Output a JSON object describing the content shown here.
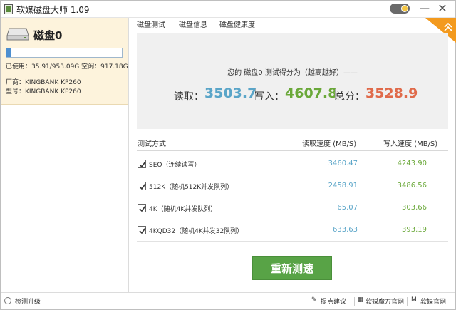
{
  "window": {
    "title": "软媒磁盘大师 1.09"
  },
  "disk": {
    "name": "磁盘0",
    "usage_fraction": 0.0376,
    "usage_text": "已使用：35.91/953.09G 空闲：917.18GB",
    "vendor": "厂商：KINGBANK KP260",
    "model": "型号：KINGBANK KP260"
  },
  "tabs": [
    {
      "label": "磁盘测试",
      "active": true
    },
    {
      "label": "磁盘信息",
      "active": false
    },
    {
      "label": "磁盘健康度",
      "active": false
    }
  ],
  "score": {
    "title": "您的 磁盘0 测试得分为（越高越好）——",
    "read_label": "读取：",
    "read_value": "3503.7",
    "write_label": "写入：",
    "write_value": "4607.8",
    "total_label": "总分：",
    "total_value": "3528.9"
  },
  "table": {
    "headers": {
      "method": "测试方式",
      "read": "读取速度 (MB/S)",
      "write": "写入速度 (MB/S)"
    },
    "rows": [
      {
        "label": "SEQ（连续读写）",
        "read": "3460.47",
        "write": "4243.90",
        "checked": true
      },
      {
        "label": "512K（随机512K并发队列）",
        "read": "2458.91",
        "write": "3486.56",
        "checked": true
      },
      {
        "label": "4K（随机4K并发队列）",
        "read": "65.07",
        "write": "303.66",
        "checked": true
      },
      {
        "label": "4KQD32（随机4K并发32队列）",
        "read": "633.63",
        "write": "393.19",
        "checked": true
      }
    ]
  },
  "retest_button": "重新测速",
  "statusbar": {
    "upgrade": "检测升级",
    "suggest": "提点建议",
    "ruanmei_magic": "软媒魔方官网",
    "ruanmei_site": "软媒官网"
  },
  "colors": {
    "read": "#5aa5c8",
    "write": "#6aa839",
    "total": "#e06a4a",
    "button": "#58a346",
    "disk_card_bg": "#fdf3dc",
    "corner_badge": "#f39a1e"
  },
  "icons": {
    "app": "app-icon",
    "disk": "hdd-icon",
    "toggle": "theme-toggle",
    "minimize": "minimize-icon",
    "close": "close-icon",
    "corner": "chevron-double-up-icon",
    "upgrade": "refresh-icon",
    "suggest": "pen-icon",
    "ruanmei": "ruanmei-logo-icon"
  }
}
